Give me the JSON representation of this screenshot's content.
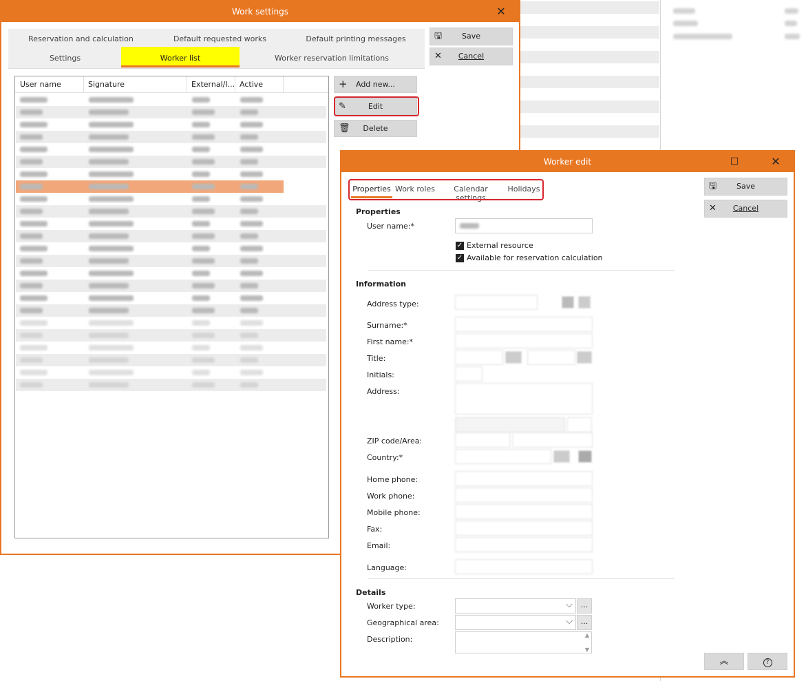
{
  "work_settings": {
    "title": "Work settings",
    "close_glyph": "✕",
    "tabs_row1": [
      "Reservation and calculation",
      "Default requested works",
      "Default printing messages"
    ],
    "tabs_row2": [
      "Settings",
      "Worker list",
      "Worker reservation limitations"
    ],
    "active_tab": "Worker list",
    "save_label": "Save",
    "cancel_label": "Cancel",
    "list_columns": [
      "User name",
      "Signature",
      "External/I...",
      "Active"
    ],
    "add_new_label": "Add new...",
    "edit_label": "Edit",
    "delete_label": "Delete",
    "accent_color": "#e87722",
    "active_tab_color": "#ffff00",
    "selected_row_color": "#f1a77a",
    "highlight_color": "#d7262e"
  },
  "worker_edit": {
    "title": "Worker edit",
    "maximize_glyph": "☐",
    "close_glyph": "✕",
    "tabs": [
      "Properties",
      "Work roles",
      "Calendar settings",
      "Holidays"
    ],
    "active_tab": "Properties",
    "save_label": "Save",
    "cancel_label": "Cancel",
    "sections": {
      "properties": "Properties",
      "information": "Information",
      "details": "Details"
    },
    "labels": {
      "user_name": "User name:*",
      "external_resource": "External resource",
      "available_for_reservation": "Available for reservation calculation",
      "address_type": "Address type:",
      "surname": "Surname:*",
      "first_name": "First name:*",
      "title": "Title:",
      "initials": "Initials:",
      "address": "Address:",
      "zip_area": "ZIP code/Area:",
      "country": "Country:*",
      "home_phone": "Home phone:",
      "work_phone": "Work phone:",
      "mobile_phone": "Mobile phone:",
      "fax": "Fax:",
      "email": "Email:",
      "language": "Language:",
      "worker_type": "Worker type:",
      "geographical_area": "Geographical area:",
      "description": "Description:"
    },
    "checkboxes": {
      "external_resource": true,
      "available_for_reservation": true
    },
    "ellipsis_label": "...",
    "scroll_top_glyph": "︽",
    "help_glyph": "?"
  }
}
